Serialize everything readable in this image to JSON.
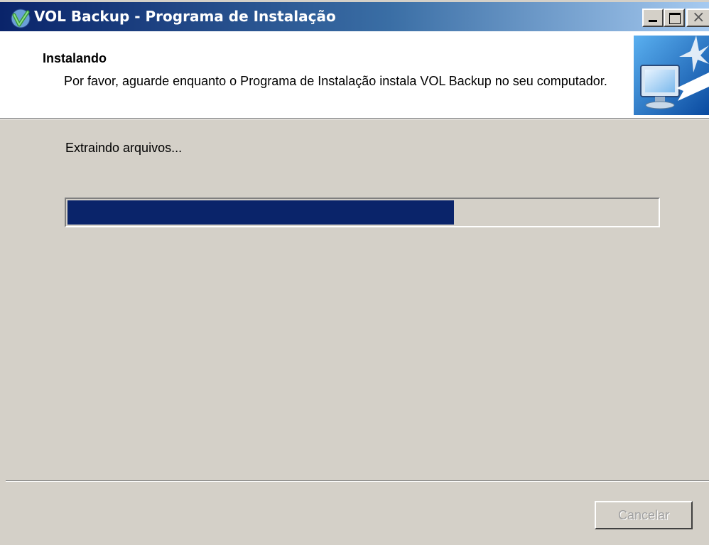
{
  "window": {
    "title": "VOL Backup - Programa de Instalação",
    "controls": {
      "minimize": "minimize",
      "maximize": "maximize",
      "close": "×"
    }
  },
  "header": {
    "title": "Instalando",
    "description": "Por favor, aguarde enquanto o Programa de Instalação instala VOL Backup no seu computador.",
    "icon": "install-computer-icon"
  },
  "body": {
    "status": "Extraindo arquivos...",
    "progress_fraction": 0.655
  },
  "footer": {
    "cancel_label": "Cancelar",
    "cancel_enabled": false
  },
  "colors": {
    "titlebar_start": "#0a246a",
    "titlebar_end": "#a6caf0",
    "progress_fill": "#0a246a",
    "dialog_bg": "#d4d0c8"
  }
}
